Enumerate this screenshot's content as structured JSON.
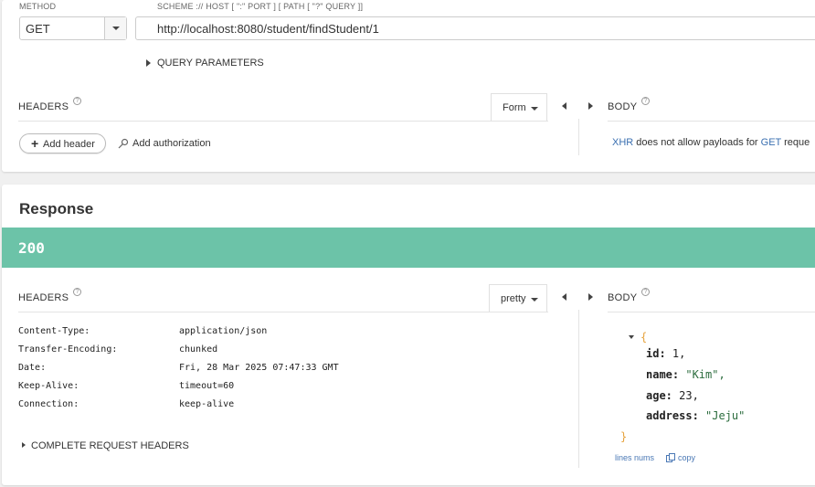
{
  "request": {
    "method_label": "METHOD",
    "method_value": "GET",
    "url_label": "SCHEME :// HOST [ \":\" PORT ] [ PATH [ \"?\" QUERY ]]",
    "url_value": "http://localhost:8080/student/findStudent/1",
    "query_params_label": "QUERY PARAMETERS",
    "headers_title": "HEADERS",
    "headers_mode": "Form",
    "body_title": "BODY",
    "add_header_label": "Add header",
    "add_authorization_label": "Add authorization",
    "body_note_prefix": "XHR",
    "body_note_mid": " does not allow payloads for ",
    "body_note_method": "GET",
    "body_note_suffix": " reque"
  },
  "response": {
    "title": "Response",
    "status_code": "200",
    "status_color": "#6cc3a8",
    "headers_title": "HEADERS",
    "headers_mode": "pretty",
    "body_title": "BODY",
    "headers": [
      {
        "key": "Content-Type:",
        "value": "application/json"
      },
      {
        "key": "Transfer-Encoding:",
        "value": "chunked"
      },
      {
        "key": "Date:",
        "value": "Fri, 28 Mar 2025 07:47:33 GMT"
      },
      {
        "key": "Keep-Alive:",
        "value": "timeout=60"
      },
      {
        "key": "Connection:",
        "value": "keep-alive"
      }
    ],
    "complete_request_headers_label": "COMPLETE REQUEST HEADERS",
    "body_json": {
      "open_brace": "{",
      "close_brace": "}",
      "fields": [
        {
          "key": "id:",
          "value": "1,"
        },
        {
          "key": "name:",
          "value": "\"Kim\","
        },
        {
          "key": "age:",
          "value": "23,"
        },
        {
          "key": "address:",
          "value": "\"Jeju\""
        }
      ]
    },
    "lines_nums_label": "lines nums",
    "copy_label": "copy"
  }
}
